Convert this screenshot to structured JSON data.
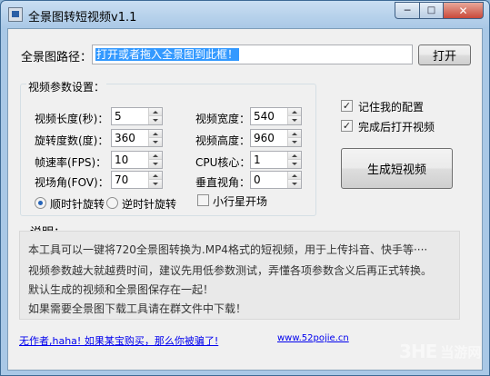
{
  "window": {
    "title": "全景图转短视频v1.1"
  },
  "path": {
    "label": "全景图路径：",
    "value": "打开或者拖入全景图到此框！",
    "open_button": "打开"
  },
  "params": {
    "group_title": "视频参数设置：",
    "fields": [
      {
        "label": "视频长度(秒)：",
        "value": "5"
      },
      {
        "label": "旋转度数(度)：",
        "value": "360"
      },
      {
        "label": "帧速率(FPS)：",
        "value": "10"
      },
      {
        "label": "视场角(FOV)：",
        "value": "70"
      },
      {
        "label": "视频宽度：",
        "value": "540"
      },
      {
        "label": "视频高度：",
        "value": "960"
      },
      {
        "label": "CPU核心：",
        "value": "1"
      },
      {
        "label": "垂直视角：",
        "value": "0"
      }
    ],
    "rotation": {
      "clockwise": "顺时针旋转",
      "counter": "逆时针旋转",
      "selected": "clockwise"
    },
    "little_planet": {
      "label": "小行星开场",
      "checked": false
    }
  },
  "options": {
    "remember": {
      "label": "记住我的配置",
      "checked": true
    },
    "open_after": {
      "label": "完成后打开视频",
      "checked": true
    },
    "generate_button": "生成短视频"
  },
  "desc": {
    "title": "说明：",
    "lines": [
      "本工具可以一键将720全景图转换为.MP4格式的短视频，用于上传抖音、快手等····",
      "视频参数越大就越费时间，建议先用低参数测试，弄懂各项参数含义后再正式转换。",
      "默认生成的视频和全景图保存在一起！",
      "如果需要全景图下载工具请在群文件中下载！"
    ]
  },
  "footer": {
    "author_link": "无作者,haha! 如果某宝购买，那么你被骗了!",
    "site_link": "www.52pojie.cn"
  },
  "watermark": {
    "mark": "3HE",
    "text": "当游网"
  },
  "icons": {
    "app": "app-icon",
    "minimize": "minimize-icon",
    "maximize": "maximize-icon",
    "close": "close-icon"
  }
}
